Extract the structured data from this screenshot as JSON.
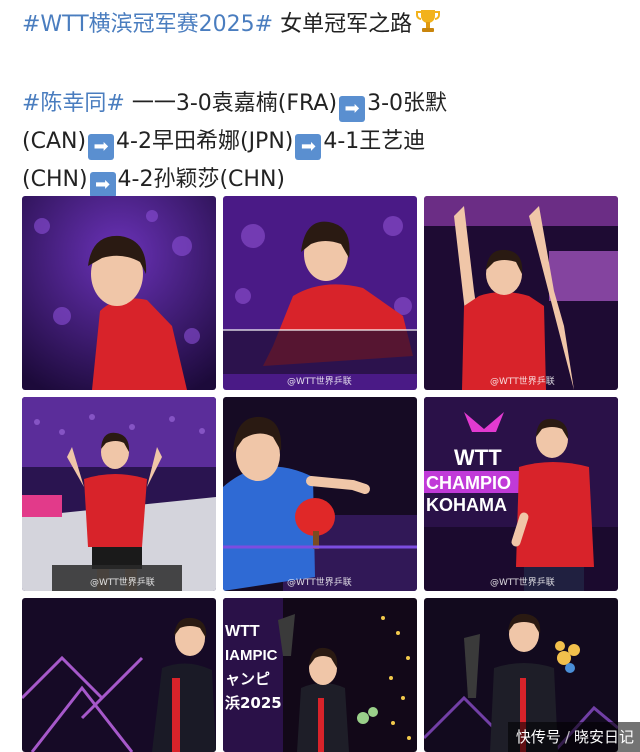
{
  "post": {
    "line1_tag": "#WTT横滨冠军赛2025#",
    "line1_text": " 女单冠军之路",
    "line2_tag": "#陈幸同#",
    "line2_text": " 一一3-0袁嘉楠(FRA)",
    "line2_after": "3-0张默",
    "line3_a": "(CAN)",
    "line3_b": "4-2早田希娜(JPN)",
    "line3_c": "4-1王艺迪",
    "line4_a": "(CHN)",
    "line4_b": "4-2孙颖莎(CHN)"
  },
  "icons": {
    "arrow": "right-arrow-icon",
    "trophy": "trophy-icon"
  },
  "photos": [
    {
      "name": "photo-1",
      "watermark": ""
    },
    {
      "name": "photo-2",
      "watermark": "@WTT世界乒联"
    },
    {
      "name": "photo-3",
      "watermark": "@WTT世界乒联"
    },
    {
      "name": "photo-4",
      "watermark": "@WTT世界乒联"
    },
    {
      "name": "photo-5",
      "watermark": "@WTT世界乒联"
    },
    {
      "name": "photo-6",
      "watermark": "@WTT世界乒联",
      "banner_wtt": "WTT",
      "banner_champ": "CHAMPIO",
      "banner_city": "KOHAMA"
    },
    {
      "name": "photo-7",
      "watermark": ""
    },
    {
      "name": "photo-8",
      "watermark": "",
      "banner_wtt": "WTT",
      "banner_champ": "IAMPIC",
      "banner_jp": "ャンピ",
      "banner_year": "浜2025"
    },
    {
      "name": "photo-9",
      "watermark": ""
    }
  ],
  "footer": {
    "app": "快传号",
    "separator": "/",
    "author": "晓安日记"
  },
  "colors": {
    "hashtag": "#4a7dbf",
    "arrow_bg": "#5a8fd0",
    "jersey_red": "#d8232a",
    "stage_purple": "#5b1d8f"
  }
}
